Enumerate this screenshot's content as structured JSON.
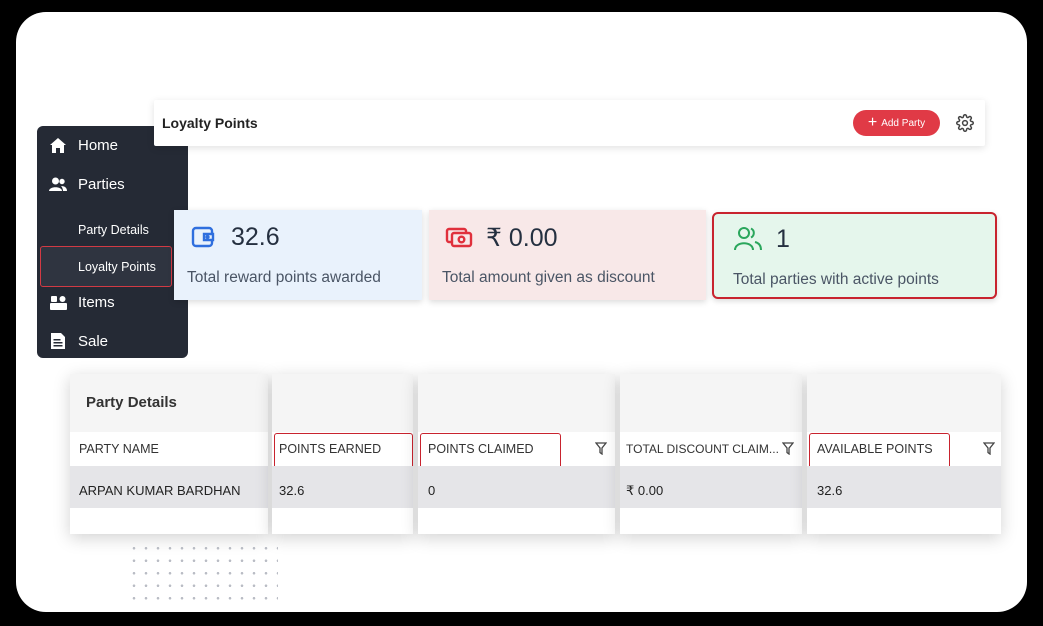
{
  "sidebar": {
    "home": "Home",
    "parties": "Parties",
    "party_details": "Party Details",
    "loyalty_points": "Loyalty Points",
    "items": "Items",
    "sale": "Sale"
  },
  "header": {
    "title": "Loyalty Points",
    "add_party": "Add Party",
    "add_color": "#e03a46"
  },
  "stats": [
    {
      "value": "32.6",
      "label": "Total reward points awarded",
      "icon": "wallet-icon",
      "color": "#2f6fde"
    },
    {
      "value": "₹ 0.00",
      "label": "Total amount given as discount",
      "icon": "cash-icon",
      "color": "#e0303c"
    },
    {
      "value": "1",
      "label": "Total parties with active points",
      "icon": "users-icon",
      "color": "#2aa65c"
    }
  ],
  "table": {
    "title": "Party Details",
    "columns": [
      "PARTY NAME",
      "POINTS EARNED",
      "POINTS CLAIMED",
      "TOTAL DISCOUNT CLAIM...",
      "AVAILABLE POINTS"
    ],
    "rows": [
      [
        "ARPAN KUMAR BARDHAN",
        "32.6",
        "0",
        "₹ 0.00",
        "32.6"
      ]
    ]
  }
}
